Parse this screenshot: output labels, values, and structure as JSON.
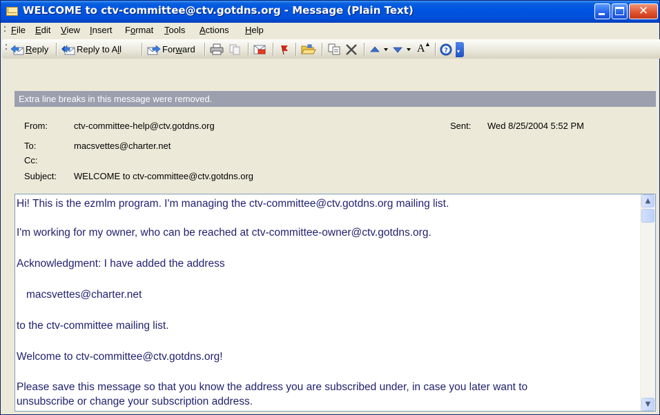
{
  "window": {
    "title": "WELCOME to ctv-committee@ctv.gotdns.org - Message (Plain Text)",
    "close_glyph": "✕"
  },
  "menu": [
    {
      "label": "File",
      "key": "F",
      "rest": "ile"
    },
    {
      "label": "Edit",
      "key": "E",
      "rest": "dit"
    },
    {
      "label": "View",
      "key": "V",
      "rest": "iew"
    },
    {
      "label": "Insert",
      "key": "I",
      "rest": "nsert"
    },
    {
      "label": "Format",
      "pre": "F",
      "key": "o",
      "rest": "rmat"
    },
    {
      "label": "Tools",
      "key": "T",
      "rest": "ools"
    },
    {
      "label": "Actions",
      "key": "A",
      "rest": "ctions"
    },
    {
      "label": "Help",
      "key": "H",
      "rest": "elp"
    }
  ],
  "toolbar": {
    "reply_label": "Reply",
    "reply_all_label": "Reply to All",
    "forward_label": "Forward",
    "font_size_glyph": "A",
    "help_glyph": "?",
    "icons": [
      "reply-icon",
      "reply-all-icon",
      "forward-icon",
      "print-icon",
      "copy-icon",
      "move-to-folder-icon",
      "flag-icon",
      "open-folder-icon",
      "address-book-icon",
      "delete-icon",
      "previous-item-icon",
      "next-item-icon",
      "font-size-icon",
      "help-icon",
      "toolbar-options-icon"
    ]
  },
  "infobar": {
    "text": "Extra line breaks in this message were removed."
  },
  "header": {
    "from_label": "From:",
    "from_value": "ctv-committee-help@ctv.gotdns.org",
    "sent_label": "Sent:",
    "sent_value": "Wed 8/25/2004 5:52 PM",
    "to_label": "To:",
    "to_value": "macsvettes@charter.net",
    "cc_label": "Cc:",
    "cc_value": "",
    "subject_label": "Subject:",
    "subject_value": "WELCOME to ctv-committee@ctv.gotdns.org"
  },
  "body": {
    "lines": [
      "Hi! This is the ezmlm program. I'm managing the ctv-committee@ctv.gotdns.org mailing list.",
      "I'm working for my owner, who can be reached at ctv-committee-owner@ctv.gotdns.org.",
      "Acknowledgment: I have added the address",
      "macsvettes@charter.net",
      "to the ctv-committee mailing list.",
      "Welcome to ctv-committee@ctv.gotdns.org!",
      "Please save this message so that you know the address you are subscribed under, in case you later want to",
      "unsubscribe or change your subscription address."
    ]
  },
  "scrollbar": {
    "up_glyph": "▲",
    "down_glyph": "▼",
    "position": 0
  },
  "colors": {
    "titlebar": "#0054e3",
    "body_text": "#1f1f6e",
    "infobar": "#9b9fae"
  }
}
